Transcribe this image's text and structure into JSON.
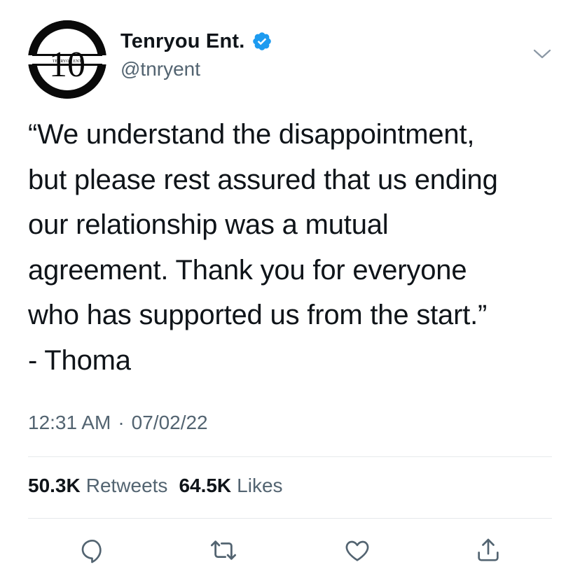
{
  "user": {
    "display_name": "Tenryou Ent.",
    "handle": "@tnryent",
    "verified": true,
    "avatar_text": "10",
    "avatar_subtext": "TENRYOU ENT."
  },
  "tweet": {
    "text": "“We understand the disappointment,\nbut please rest assured that us ending\nour relationship was a mutual\nagreement. Thank you for everyone\nwho has supported us from the start.”\n- Thoma",
    "time": "12:31 AM",
    "separator": "·",
    "date": "07/02/22"
  },
  "stats": {
    "retweets_count": "50.3K",
    "retweets_label": "Retweets",
    "likes_count": "64.5K",
    "likes_label": "Likes"
  },
  "colors": {
    "text": "#0f1419",
    "secondary": "#536471",
    "verified": "#1d9bf0",
    "divider": "#e6e9ec"
  },
  "icons": {
    "more": "chevron-down-icon",
    "reply": "reply-icon",
    "retweet": "retweet-icon",
    "like": "heart-icon",
    "share": "share-icon"
  }
}
